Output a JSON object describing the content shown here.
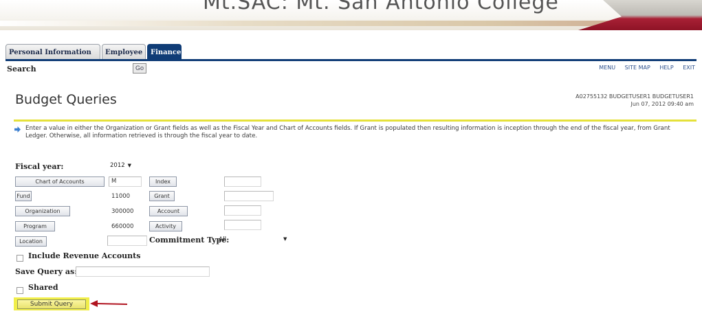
{
  "banner": {
    "title": "Mt.SAC: Mt. San Antonio College"
  },
  "tabs": [
    {
      "label": "Personal Information",
      "active": false
    },
    {
      "label": "Employee",
      "active": false
    },
    {
      "label": "Finance",
      "active": true
    }
  ],
  "search": {
    "label": "Search",
    "value": "",
    "go_label": "Go"
  },
  "topnav": {
    "menu": "MENU",
    "site_map": "SITE MAP",
    "help": "HELP",
    "exit": "EXIT"
  },
  "page": {
    "title": "Budget Queries"
  },
  "user": {
    "id_line": "A02755132 BUDGETUSER1 BUDGETUSER1",
    "datetime": "Jun 07, 2012 09:40 am"
  },
  "info": {
    "icon": "info-arrow-icon",
    "text": "Enter a value in either the Organization or Grant fields as well as the Fiscal Year and Chart of Accounts fields. If Grant is populated then resulting information is inception through the end of the fiscal year, from Grant Ledger. Otherwise, all information retrieved is through the fiscal year to date."
  },
  "form": {
    "fiscal_year": {
      "label": "Fiscal year:",
      "value": "2012"
    },
    "chart_of_accounts": {
      "label": "Chart of Accounts",
      "value": "M"
    },
    "fund": {
      "label": "Fund",
      "value": "11000"
    },
    "organization": {
      "label": "Organization",
      "value": "300000"
    },
    "program": {
      "label": "Program",
      "value": "660000"
    },
    "location": {
      "label": "Location",
      "value": ""
    },
    "index": {
      "label": "Index",
      "value": ""
    },
    "grant": {
      "label": "Grant",
      "value": ""
    },
    "account": {
      "label": "Account",
      "value": ""
    },
    "activity": {
      "label": "Activity",
      "value": ""
    },
    "commitment_type": {
      "label": "Commitment Type:",
      "value": "All"
    },
    "include_revenue": {
      "label": "Include Revenue Accounts",
      "checked": false
    },
    "save_query": {
      "label": "Save Query as:",
      "value": ""
    },
    "shared": {
      "label": "Shared",
      "checked": false
    },
    "submit": {
      "label": "Submit Query"
    }
  },
  "colors": {
    "nav_blue": "#0f3c76",
    "highlight_yellow": "#f1ee4a",
    "annotation_arrow": "#b0131f"
  }
}
